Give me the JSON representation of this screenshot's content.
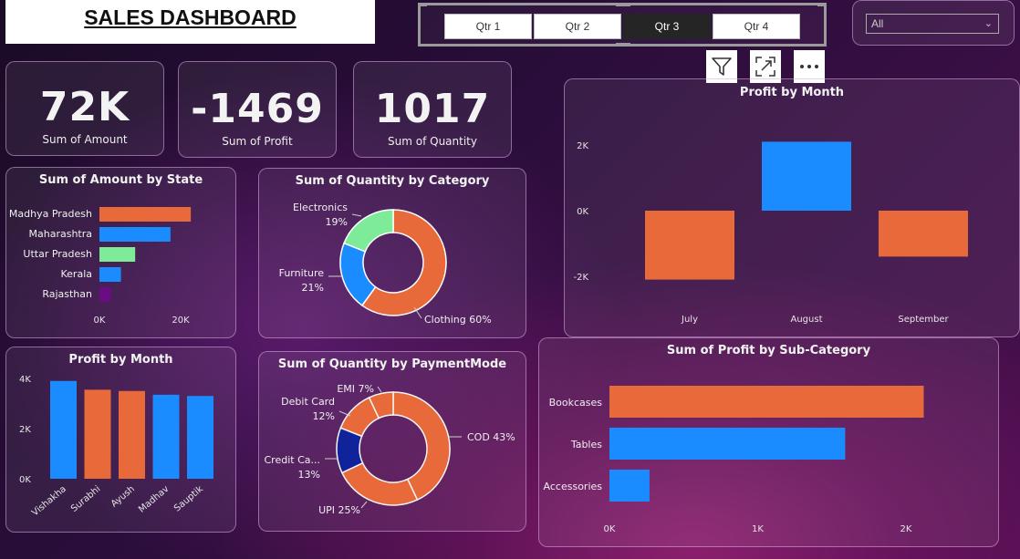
{
  "header": {
    "title": "SALES DASHBOARD",
    "quarters": [
      "Qtr 1",
      "Qtr 2",
      "Qtr 3",
      "Qtr 4"
    ],
    "selected_quarter": "Qtr 3",
    "dropdown_value": "All"
  },
  "toolbar": {
    "filter_icon": "filter-icon",
    "focus_icon": "focus-mode-icon",
    "more_icon": "more-options-icon"
  },
  "kpis": [
    {
      "value": "72K",
      "label": "Sum of Amount"
    },
    {
      "value": "-1469",
      "label": "Sum of Profit"
    },
    {
      "value": "1017",
      "label": "Sum of Quantity"
    }
  ],
  "colors": {
    "orange": "#E8693A",
    "blue": "#1A8CFF",
    "green": "#7EEB98",
    "purple": "#6A0D83",
    "navy": "#10239A"
  },
  "chart_data": [
    {
      "id": "amount_by_state",
      "type": "bar",
      "orientation": "horizontal",
      "title": "Sum of Amount by State",
      "categories": [
        "Madhya Pradesh",
        "Maharashtra",
        "Uttar Pradesh",
        "Kerala",
        "Rajasthan"
      ],
      "values": [
        22500,
        17500,
        8800,
        5300,
        2800
      ],
      "colors": [
        "#E8693A",
        "#1A8CFF",
        "#7EEB98",
        "#1A8CFF",
        "#6A0D83"
      ],
      "xlim": [
        0,
        20000
      ],
      "xticks": [
        "0K",
        "20K"
      ]
    },
    {
      "id": "quantity_by_category",
      "type": "pie",
      "donut": true,
      "title": "Sum of Quantity by Category",
      "labels": [
        "Clothing",
        "Furniture",
        "Electronics"
      ],
      "values": [
        60,
        21,
        19
      ],
      "display": [
        "Clothing 60%",
        "Furniture",
        "Electronics"
      ],
      "pcts": [
        "",
        "21%",
        "19%"
      ],
      "colors": [
        "#E8693A",
        "#1A8CFF",
        "#7EEB98"
      ]
    },
    {
      "id": "profit_by_month_q",
      "type": "bar",
      "title": "Profit by Month",
      "categories": [
        "July",
        "August",
        "September"
      ],
      "values": [
        -2100,
        2100,
        -1400
      ],
      "colors": [
        "#E8693A",
        "#1A8CFF",
        "#E8693A"
      ],
      "yticks": [
        "2K",
        "0K",
        "-2K"
      ]
    },
    {
      "id": "profit_by_person",
      "type": "bar",
      "title": "Profit by Month",
      "categories": [
        "Vishakha",
        "Surabhi",
        "Ayush",
        "Madhav",
        "Sauptik"
      ],
      "values": [
        3900,
        3550,
        3500,
        3350,
        3300
      ],
      "colors": [
        "#1A8CFF",
        "#E8693A",
        "#E8693A",
        "#1A8CFF",
        "#1A8CFF"
      ],
      "ylim": [
        0,
        4000
      ],
      "yticks": [
        "4K",
        "2K",
        "0K"
      ]
    },
    {
      "id": "quantity_by_paymentmode",
      "type": "pie",
      "donut": true,
      "title": "Sum of Quantity by PaymentMode",
      "labels": [
        "COD",
        "UPI",
        "Credit Card",
        "Debit Card",
        "EMI"
      ],
      "values": [
        43,
        25,
        13,
        12,
        7
      ],
      "display": [
        "COD 43%",
        "UPI 25%",
        "Credit Ca...",
        "Debit Card",
        "EMI 7%"
      ],
      "pcts": [
        "",
        "",
        "13%",
        "12%",
        ""
      ],
      "colors": [
        "#E8693A",
        "#E8693A",
        "#10239A",
        "#E8693A",
        "#E8693A"
      ]
    },
    {
      "id": "profit_by_subcategory",
      "type": "bar",
      "orientation": "horizontal",
      "title": "Sum of Profit by Sub-Category",
      "categories": [
        "Bookcases",
        "Tables",
        "Accessories"
      ],
      "values": [
        2120,
        1590,
        270
      ],
      "colors": [
        "#E8693A",
        "#1A8CFF",
        "#1A8CFF"
      ],
      "xlim": [
        0,
        2000
      ],
      "xticks": [
        "0K",
        "1K",
        "2K"
      ]
    }
  ]
}
